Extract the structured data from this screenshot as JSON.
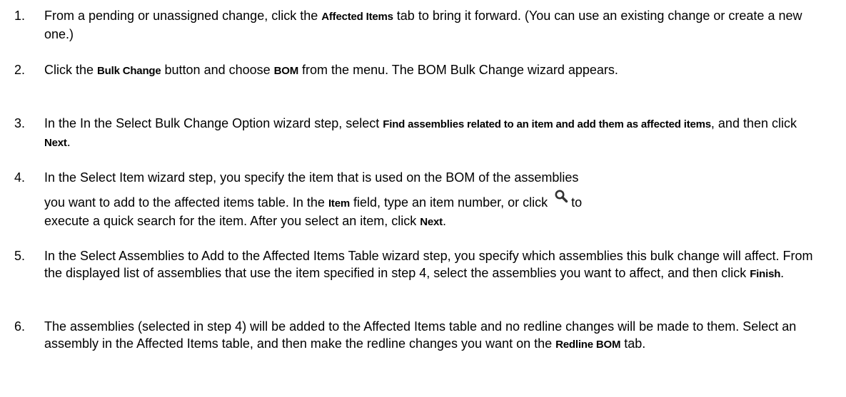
{
  "steps": [
    {
      "number": "1.",
      "before": "From a pending or unassigned change, click the ",
      "bold1": "Affected Items",
      "after": " tab to bring it forward. (You can use an existing change or create a new one.)"
    },
    {
      "number": "2.",
      "before": "Click the ",
      "bold1": "Bulk Change",
      "mid": " button and choose ",
      "bold2": "BOM",
      "after": " from the menu. The BOM Bulk Change wizard appears."
    },
    {
      "number": "3.",
      "before": "In the In the Select Bulk Change Option wizard step, select ",
      "bold1": "Find assemblies related to an item and add them as affected items",
      "mid": ", and then click ",
      "bold2": "Next",
      "after": "."
    },
    {
      "number": "4.",
      "line1": "In the Select Item wizard step, you specify the item that is used on the BOM of the assemblies",
      "before": "you want to add to the affected items table. In the ",
      "bold1": "Item",
      "mid": " field, type an item number, or click ",
      "icon": "search-icon",
      "after_icon": "to",
      "line3_before": "execute a quick search for the item. After you select an item, click ",
      "bold2": "Next",
      "after": "."
    },
    {
      "number": "5.",
      "before": "In the Select Assemblies to Add to the Affected Items Table wizard step, you specify which assemblies this bulk change will affect. From the displayed list of assemblies that use the item specified in step 4, select the assemblies you want to affect, and then click ",
      "bold1": "Finish",
      "after": "."
    },
    {
      "number": "6.",
      "before": "The assemblies (selected in step 4) will be added to the Affected Items table and no redline changes will be made to them. Select an assembly in the Affected Items table, and then make the redline changes you want on the ",
      "bold1": "Redline BOM",
      "after": " tab."
    }
  ],
  "colors": {
    "text": "#000000",
    "background": "#ffffff",
    "icon": "#333333"
  }
}
